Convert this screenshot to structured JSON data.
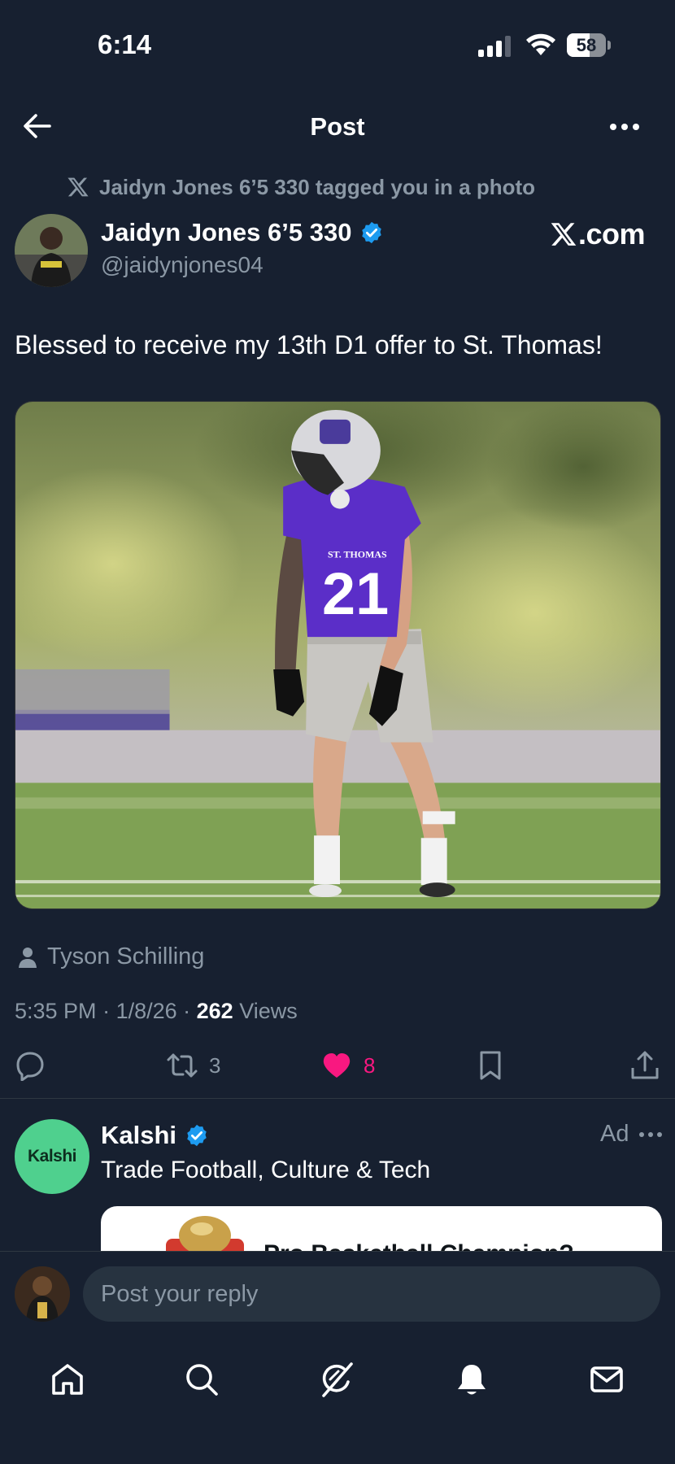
{
  "status_bar": {
    "time": "6:14",
    "battery_level": "58",
    "battery_fraction": 0.58
  },
  "header": {
    "title": "Post",
    "back_icon": "arrow-left-icon",
    "more_icon": "more-horizontal-icon"
  },
  "post": {
    "tagged_text": "Jaidyn Jones 6’5 330 tagged you in a photo",
    "author_name": "Jaidyn Jones 6’5 330",
    "author_handle": "@jaidynjones04",
    "verified": true,
    "source_logo_text": ".com",
    "text": "Blessed to receive my 13th D1 offer to St. Thomas!",
    "photo": {
      "jersey_text": "ST. THOMAS",
      "jersey_number": "21"
    },
    "photo_credit": "Tyson Schilling",
    "time": "5:35 PM",
    "date": "1/8/26",
    "views_count": "262",
    "views_label": "Views",
    "separator": " · ",
    "actions": {
      "reply_count": "",
      "repost_count": "3",
      "like_count": "8",
      "liked": true
    }
  },
  "ad": {
    "avatar_text": "Kalshi",
    "name": "Kalshi",
    "verified": true,
    "label": "Ad",
    "tagline": "Trade Football, Culture & Tech",
    "card_title": "Pro Basketball Champion?"
  },
  "reply": {
    "placeholder": "Post your reply"
  },
  "nav": {
    "items": [
      "home-icon",
      "search-icon",
      "grok-icon",
      "notifications-icon",
      "messages-icon"
    ]
  },
  "colors": {
    "background": "#172030",
    "accent_blue": "#1d9bf0",
    "like_pink": "#f91880",
    "muted_text": "#8b98a5",
    "ad_avatar_green": "#4fd08e"
  }
}
